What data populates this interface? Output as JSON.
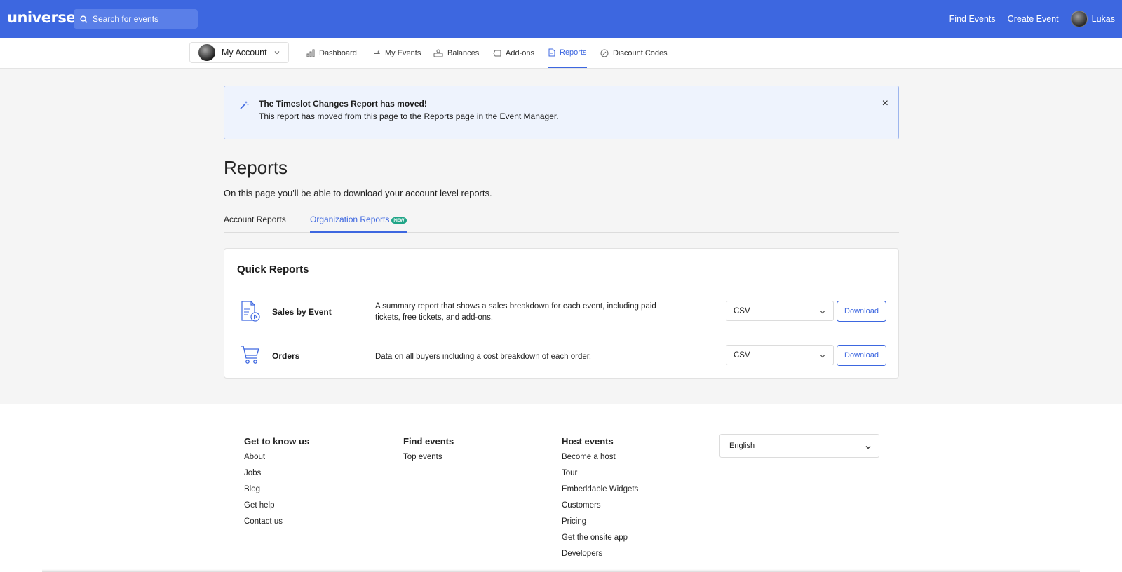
{
  "header": {
    "logo": "universe",
    "search_placeholder": "Search for events",
    "links": [
      "Find Events",
      "Create Event"
    ],
    "user_name": "Lukas"
  },
  "subnav": {
    "account_label": "My Account",
    "items": [
      {
        "label": "Dashboard",
        "icon": "bar-chart-icon"
      },
      {
        "label": "My Events",
        "icon": "flag-icon"
      },
      {
        "label": "Balances",
        "icon": "money-hand-icon"
      },
      {
        "label": "Add-ons",
        "icon": "tag-icon"
      },
      {
        "label": "Reports",
        "icon": "document-icon",
        "active": true
      },
      {
        "label": "Discount Codes",
        "icon": "discount-icon"
      }
    ]
  },
  "banner": {
    "title": "The Timeslot Changes Report has moved!",
    "text": "This report has moved from this page to the Reports page in the Event Manager.",
    "close": "×"
  },
  "page": {
    "title": "Reports",
    "subtitle": "On this page you'll be able to download your account level reports."
  },
  "tabs": {
    "account": "Account Reports",
    "organization": "Organization Reports",
    "new_badge": "NEW"
  },
  "quick_reports": {
    "title": "Quick Reports",
    "rows": [
      {
        "name": "Sales by Event",
        "description": "A summary report that shows a sales breakdown for each event, including paid tickets, free tickets, and add-ons.",
        "format": "CSV",
        "button": "Download",
        "icon": "report-document-icon"
      },
      {
        "name": "Orders",
        "description": "Data on all buyers including a cost breakdown of each order.",
        "format": "CSV",
        "button": "Download",
        "icon": "cart-icon"
      }
    ]
  },
  "footer": {
    "know_us": {
      "title": "Get to know us",
      "links": [
        "About",
        "Jobs",
        "Blog",
        "Get help",
        "Contact us"
      ]
    },
    "find_events": {
      "title": "Find events",
      "links": [
        "Top events"
      ]
    },
    "host_events": {
      "title": "Host events",
      "links": [
        "Become a host",
        "Tour",
        "Embeddable Widgets",
        "Customers",
        "Pricing",
        "Get the onsite app",
        "Developers"
      ]
    },
    "language": "English"
  },
  "colors": {
    "brand": "#3d67e0",
    "badge": "#1fa587",
    "banner_bg": "#eef3fd"
  }
}
